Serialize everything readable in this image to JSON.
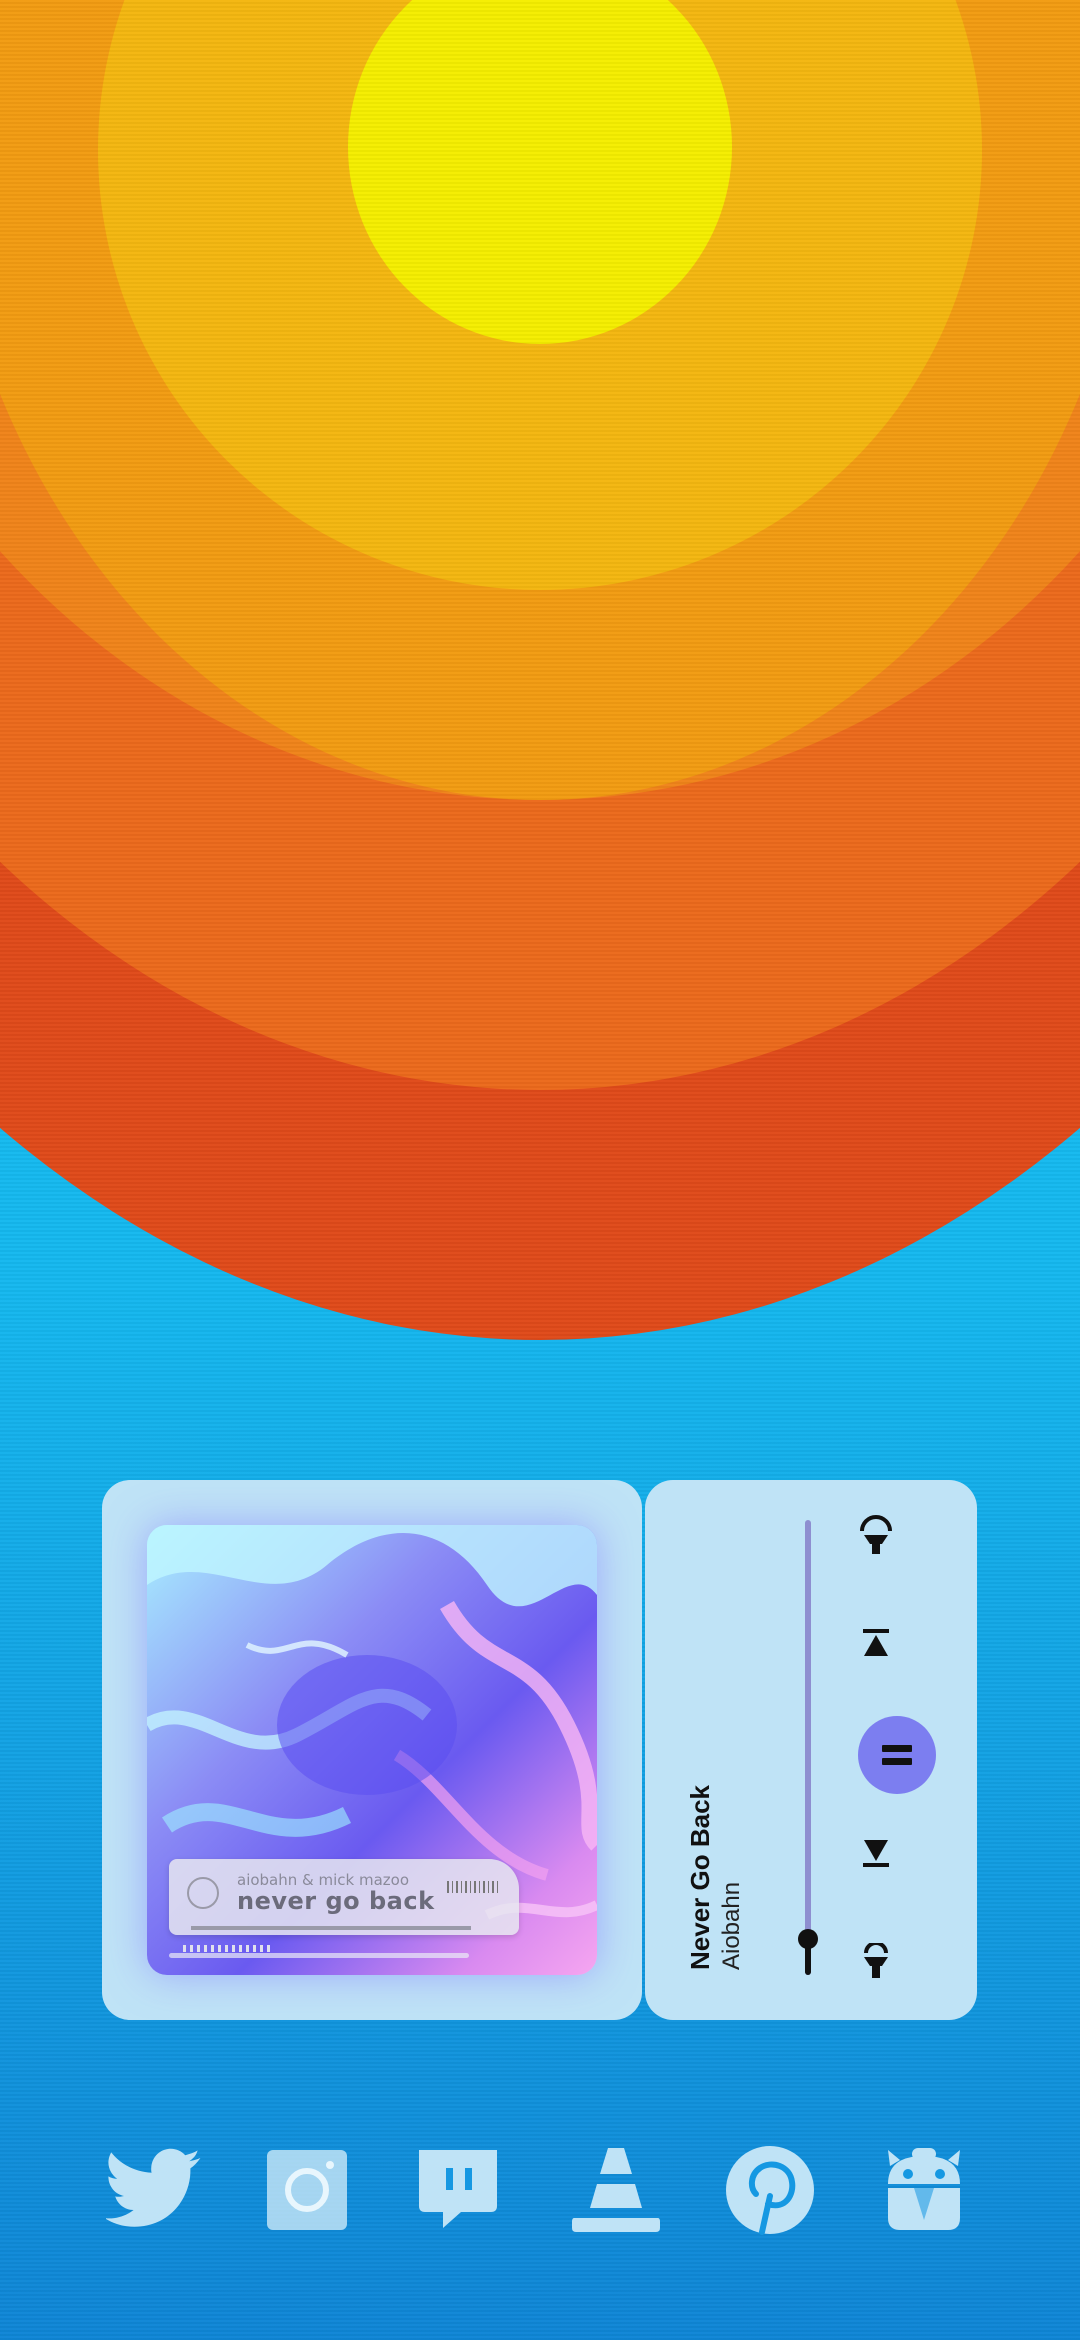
{
  "wallpaper": {
    "colors": {
      "sky_top": "#19c9f2",
      "sky_bottom": "#0f86d6",
      "ring_1": "#e04a1a",
      "ring_2": "#ec6a1c",
      "ring_3": "#f0841a",
      "ring_4": "#f29c12",
      "ring_5": "#f4b710",
      "sun": "#f5ee00"
    }
  },
  "music_widget": {
    "album_art": {
      "artist_text": "aiobahn & mick mazoo",
      "title_text": "never go back"
    },
    "track": {
      "title": "Never Go Back",
      "artist": "Aiobahn"
    },
    "progress": 0.08,
    "accent_color": "#7c7ef0",
    "controls": [
      "scroll-up-icon",
      "previous-track-icon",
      "pause-icon",
      "next-track-icon",
      "scroll-down-icon"
    ]
  },
  "dock": {
    "apps": [
      {
        "name": "Twitter",
        "icon": "twitter-icon"
      },
      {
        "name": "Instagram",
        "icon": "instagram-icon"
      },
      {
        "name": "Twitch",
        "icon": "twitch-icon"
      },
      {
        "name": "VLC",
        "icon": "vlc-icon"
      },
      {
        "name": "Pinterest",
        "icon": "pinterest-icon"
      },
      {
        "name": "App",
        "icon": "android-robot-icon"
      }
    ],
    "icon_color": "#bfe3f6"
  }
}
